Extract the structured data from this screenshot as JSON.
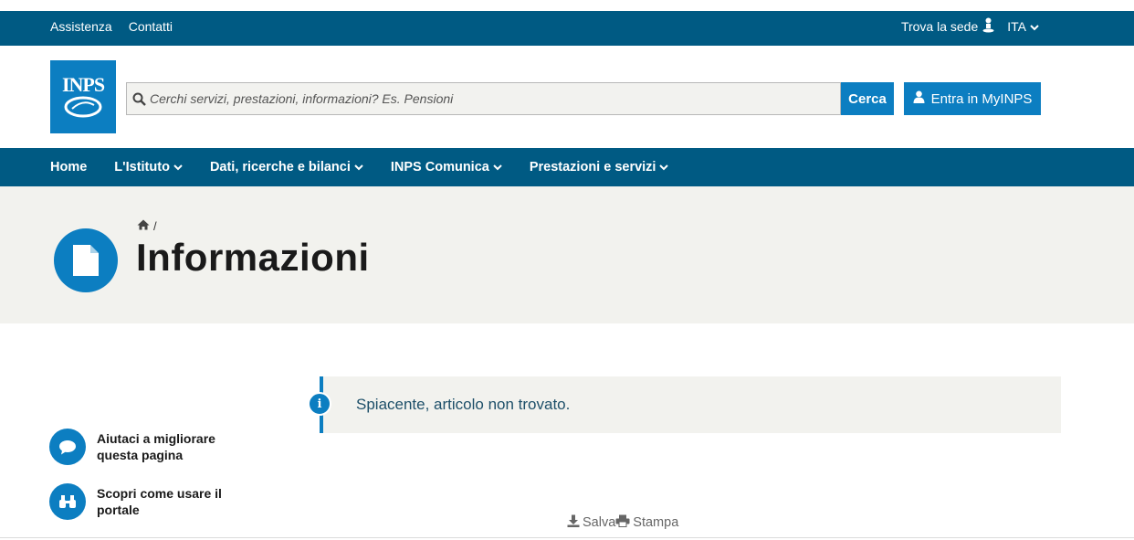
{
  "topbar": {
    "assistance": "Assistenza",
    "contacts": "Contatti",
    "find_office": "Trova la sede",
    "language": "ITA"
  },
  "header": {
    "logo_text": "INPS",
    "search_placeholder": "Cerchi servizi, prestazioni, informazioni? Es. Pensioni",
    "search_button": "Cerca",
    "login_button": "Entra in MyINPS"
  },
  "nav": {
    "items": [
      {
        "label": "Home",
        "dropdown": false
      },
      {
        "label": "L'Istituto",
        "dropdown": true
      },
      {
        "label": "Dati, ricerche e bilanci",
        "dropdown": true
      },
      {
        "label": "INPS Comunica",
        "dropdown": true
      },
      {
        "label": "Prestazioni e servizi",
        "dropdown": true
      }
    ]
  },
  "hero": {
    "breadcrumb_separator": "/",
    "title": "Informazioni"
  },
  "alert": {
    "message": "Spiacente, articolo non trovato."
  },
  "sidebar": {
    "feedback": "Aiutaci a migliorare questa pagina",
    "guide": "Scopri come usare il portale"
  },
  "tools": {
    "save": "Salva",
    "print": "Stampa"
  },
  "colors": {
    "brand_dark": "#005a83",
    "brand": "#0c7ec1",
    "hero_bg": "#f2f2ee"
  }
}
